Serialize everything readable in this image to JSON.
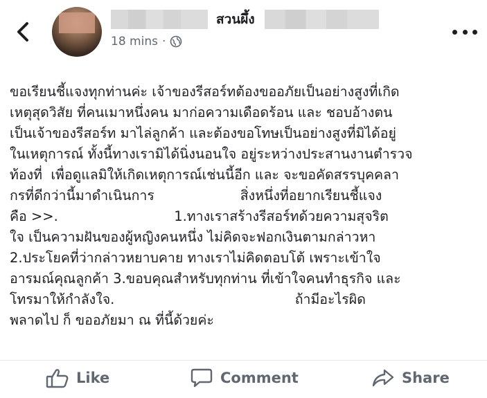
{
  "header": {
    "page_name": "สวนผึ้ง",
    "time": "18 mins",
    "separator": "·"
  },
  "post": {
    "lines": [
      "ขอเรียนชี้แจงทุกท่านค่ะ เจ้าของรีสอร์ทต้องขออภัยเป็นอย่างสูงที่เกิด",
      "เหตุสุดวิสัย ที่คนเมาหนึ่งคน มาก่อความเดือดร้อน และ ชอบอ้างตน",
      "เป็นเจ้าของรีสอร์ท มาไล่ลูกค้า และต้องขอโทษเป็นอย่างสูงที่มิได้อยู่",
      "ในเหตุการณ์ ทั้งนี้ทางเรามิได้นิ่งนอนใจ อยู่ระหว่างประสานงานตำรวจ",
      "ท้องที่  เพื่อดูแลมิให้เกิดเหตุการณ์เช่นนี้อีก และ จะขอคัดสรรบุคคลา",
      "กรที่ดีกว่านี้มาดำเนินการ                    สิ่งหนึ่งที่อยากเรียนชี้แจง",
      "คือ >>.                           1.ทางเราสร้างรีสอร์ทด้วยความสุจริต",
      "ใจ เป็นความฝันของผู้หญิงคนหนึ่ง ไม่คิดจะฟอกเงินตามกล่าวหา",
      "2.ประโยคที่ว่ากล่าวหยาบคาย ทางเราไม่คิดตอบโต้ เพราะเข้าใจ",
      "อารมณ์คุณลูกค้า 3.ขอบคุณสำหรับทุกท่าน ที่เข้าใจคนทำธุรกิจ และ",
      "โทรมาให้กำลังใจ.                                          ถ้ามีอะไรผิด",
      "พลาดไป ก็ ขออภัยมา ณ ที่นี้ด้วยค่ะ"
    ]
  },
  "actions": {
    "like": "Like",
    "comment": "Comment",
    "share": "Share"
  },
  "icons": {
    "back": "chevron-left-icon",
    "globe": "globe-icon",
    "more": "more-dots-icon",
    "like": "thumbs-up-icon",
    "comment": "comment-bubble-icon",
    "share": "share-arrow-icon"
  },
  "colors": {
    "text": "#1c1e21",
    "meta": "#606770",
    "divider": "#e6e6e6"
  }
}
